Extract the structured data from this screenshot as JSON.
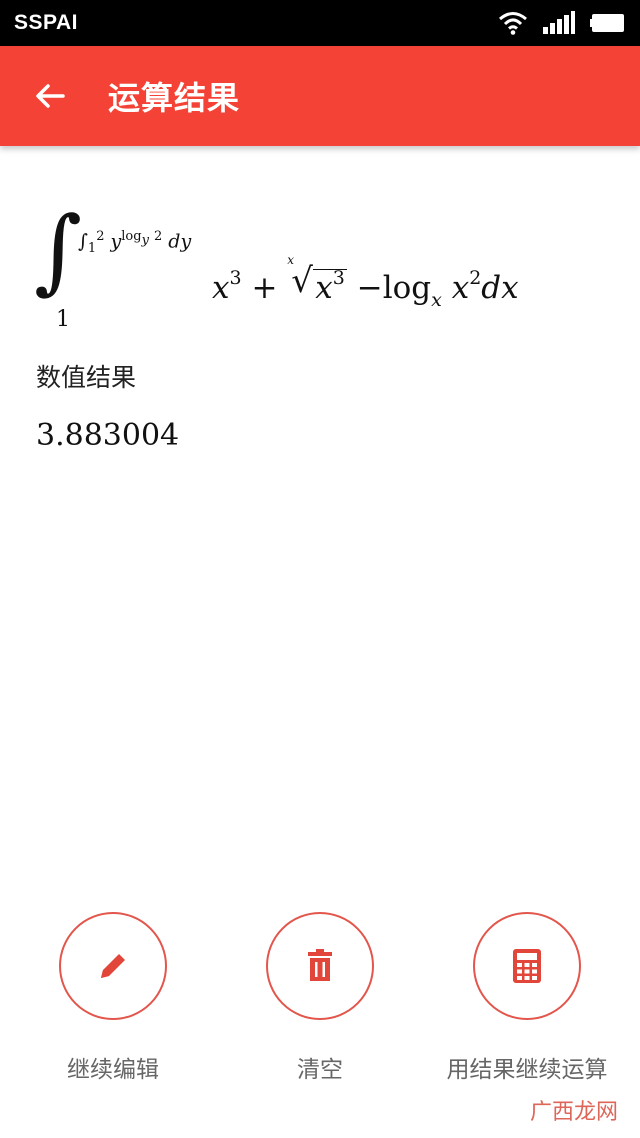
{
  "status_bar": {
    "carrier": "SSPAI"
  },
  "app_bar": {
    "title": "运算结果"
  },
  "formula": {
    "integral_lower": "1",
    "upper_int_symbol": "∫",
    "upper_int_lower": "1",
    "upper_int_upper": "2",
    "upper_base": "y",
    "upper_exp_log": "log",
    "upper_exp_log_base": "y",
    "upper_exp_arg": "2",
    "upper_diff": "dy",
    "term1_var": "x",
    "term1_exp": "3",
    "plus": "+",
    "root_index": "x",
    "root_var": "x",
    "root_exp": "3",
    "minus": "−",
    "log": "log",
    "log_base": "x",
    "log_arg": "x",
    "log_arg_exp": "2",
    "diff": "dx"
  },
  "result": {
    "label": "数值结果",
    "value": "3.883004"
  },
  "actions": [
    {
      "label": "继续编辑",
      "icon": "pencil-icon"
    },
    {
      "label": "清空",
      "icon": "trash-icon"
    },
    {
      "label": "用结果继续运算",
      "icon": "calculator-icon"
    }
  ],
  "watermark": "广西龙网",
  "colors": {
    "accent": "#f44336",
    "button_border": "#e2564c",
    "icon": "#e2453a"
  }
}
